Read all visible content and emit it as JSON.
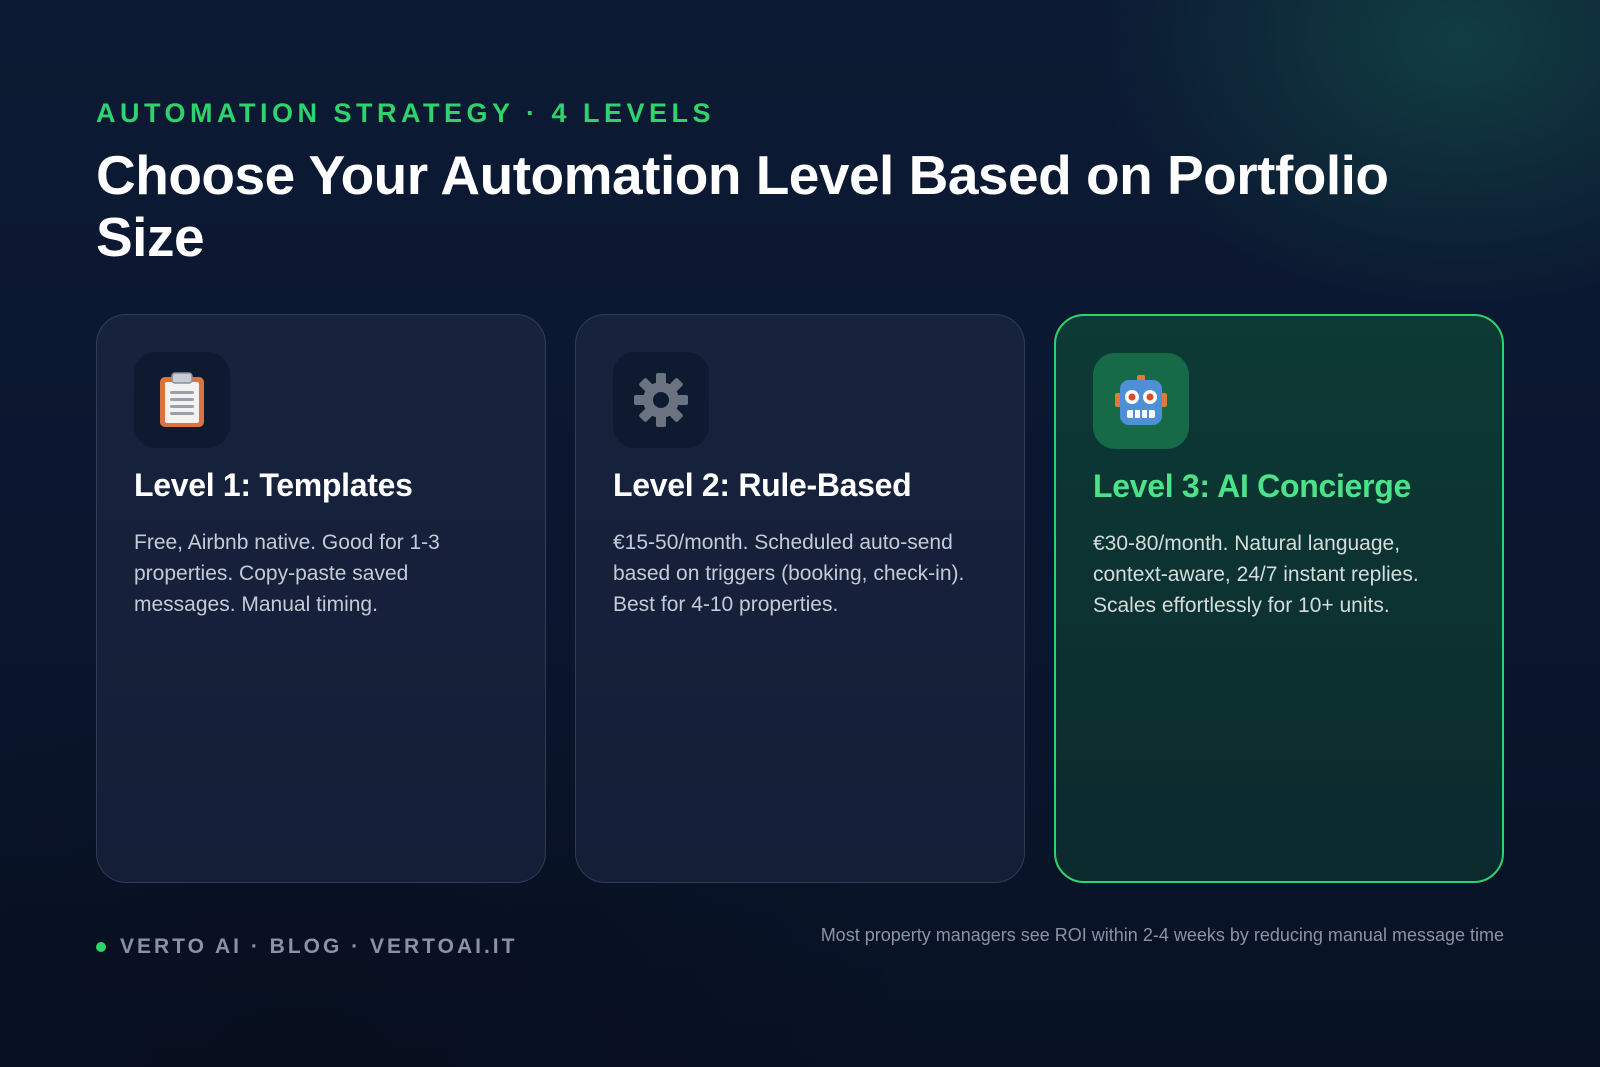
{
  "header": {
    "eyebrow": "AUTOMATION STRATEGY · 4 LEVELS",
    "title": "Choose Your Automation Level Based on Portfolio Size"
  },
  "cards": [
    {
      "icon": "clipboard-icon",
      "title": "Level 1: Templates",
      "description": "Free, Airbnb native. Good for 1-3 properties. Copy-paste saved messages. Manual timing."
    },
    {
      "icon": "gear-icon",
      "title": "Level 2: Rule-Based",
      "description": "€15-50/month. Scheduled auto-send based on triggers (booking, check-in). Best for 4-10 properties."
    },
    {
      "icon": "robot-icon",
      "title": "Level 3: AI Concierge",
      "description": "€30-80/month. Natural language, context-aware, 24/7 instant replies. Scales effortlessly for 10+ units.",
      "highlighted": true
    }
  ],
  "footer": {
    "brand": "VERTO AI · BLOG · VERTOAI.IT",
    "note": "Most property managers see ROI within 2-4 weeks by reducing manual message time"
  },
  "colors": {
    "accent": "#2fd36e",
    "background": "#0a1426",
    "card": "#17223d",
    "highlight_card": "#0d3a35"
  }
}
